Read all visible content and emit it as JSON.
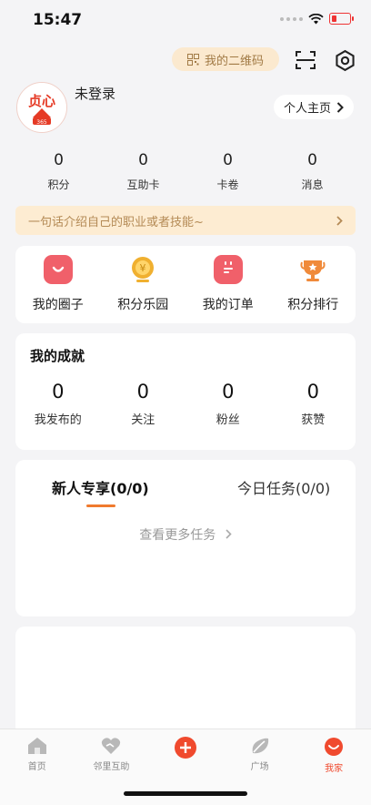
{
  "status_bar": {
    "time": "15:47"
  },
  "header": {
    "qr_label": "我的二维码"
  },
  "profile": {
    "avatar_brand": "贞心",
    "avatar_badge": "365",
    "login_text": "未登录",
    "homepage_label": "个人主页"
  },
  "stats": [
    {
      "value": "0",
      "label": "积分"
    },
    {
      "value": "0",
      "label": "互助卡"
    },
    {
      "value": "0",
      "label": "卡卷"
    },
    {
      "value": "0",
      "label": "消息"
    }
  ],
  "bio": {
    "placeholder": "一句话介绍自己的职业或者技能~"
  },
  "features": [
    {
      "label": "我的圈子",
      "icon": "smile-icon",
      "color": "#f0606a"
    },
    {
      "label": "积分乐园",
      "icon": "coin-icon",
      "color": "#f0b030"
    },
    {
      "label": "我的订单",
      "icon": "calendar-icon",
      "color": "#f0606a"
    },
    {
      "label": "积分排行",
      "icon": "trophy-icon",
      "color": "#f08a3a"
    }
  ],
  "achievements": {
    "title": "我的成就",
    "items": [
      {
        "value": "0",
        "label": "我发布的"
      },
      {
        "value": "0",
        "label": "关注"
      },
      {
        "value": "0",
        "label": "粉丝"
      },
      {
        "value": "0",
        "label": "获赞"
      }
    ]
  },
  "tasks": {
    "tab_new": "新人专享(0/0)",
    "tab_today": "今日任务(0/0)",
    "more": "查看更多任务"
  },
  "tab_bar": {
    "items": [
      {
        "label": "首页",
        "icon": "home-icon"
      },
      {
        "label": "邻里互助",
        "icon": "heart-hands-icon"
      },
      {
        "label": "",
        "icon": "plus-icon"
      },
      {
        "label": "广场",
        "icon": "leaf-icon"
      },
      {
        "label": "我家",
        "icon": "smile-icon"
      }
    ]
  },
  "colors": {
    "accent": "#f04a2e",
    "task_underline": "#f07a2e",
    "pill_bg": "#fbe9cf"
  }
}
